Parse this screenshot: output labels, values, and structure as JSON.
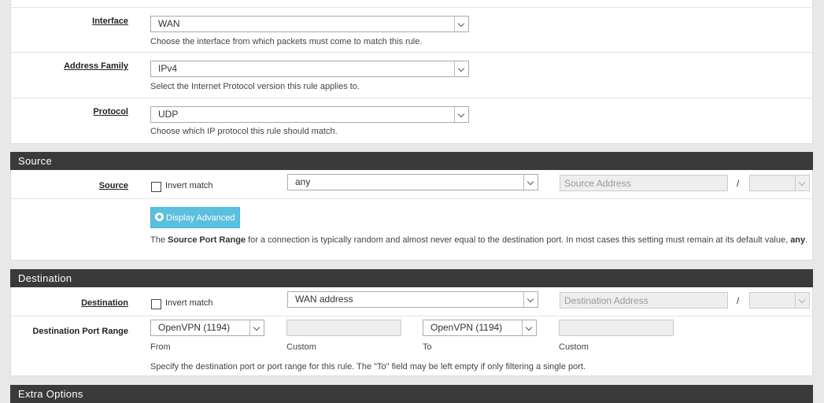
{
  "interface": {
    "label": "Interface",
    "value": "WAN",
    "help": "Choose the interface from which packets must come to match this rule."
  },
  "address_family": {
    "label": "Address Family",
    "value": "IPv4",
    "help": "Select the Internet Protocol version this rule applies to."
  },
  "protocol": {
    "label": "Protocol",
    "value": "UDP",
    "help": "Choose which IP protocol this rule should match."
  },
  "source_section": {
    "title": "Source",
    "label": "Source",
    "invert_label": "Invert match",
    "type_value": "any",
    "address_placeholder": "Source Address",
    "slash": "/",
    "advanced_button": "Display Advanced",
    "help_prefix": "The ",
    "help_bold": "Source Port Range",
    "help_mid": " for a connection is typically random and almost never equal to the destination port. In most cases this setting must remain at its default value, ",
    "help_bold2": "any",
    "help_suffix": "."
  },
  "destination_section": {
    "title": "Destination",
    "label": "Destination",
    "invert_label": "Invert match",
    "type_value": "WAN address",
    "address_placeholder": "Destination Address",
    "slash": "/",
    "port_range_label": "Destination Port Range",
    "from_value": "OpenVPN (1194)",
    "to_value": "OpenVPN (1194)",
    "from_label": "From",
    "custom_label_1": "Custom",
    "to_label": "To",
    "custom_label_2": "Custom",
    "help": "Specify the destination port or port range for this rule. The \"To\" field may be left empty if only filtering a single port."
  },
  "extra_section": {
    "title": "Extra Options"
  }
}
